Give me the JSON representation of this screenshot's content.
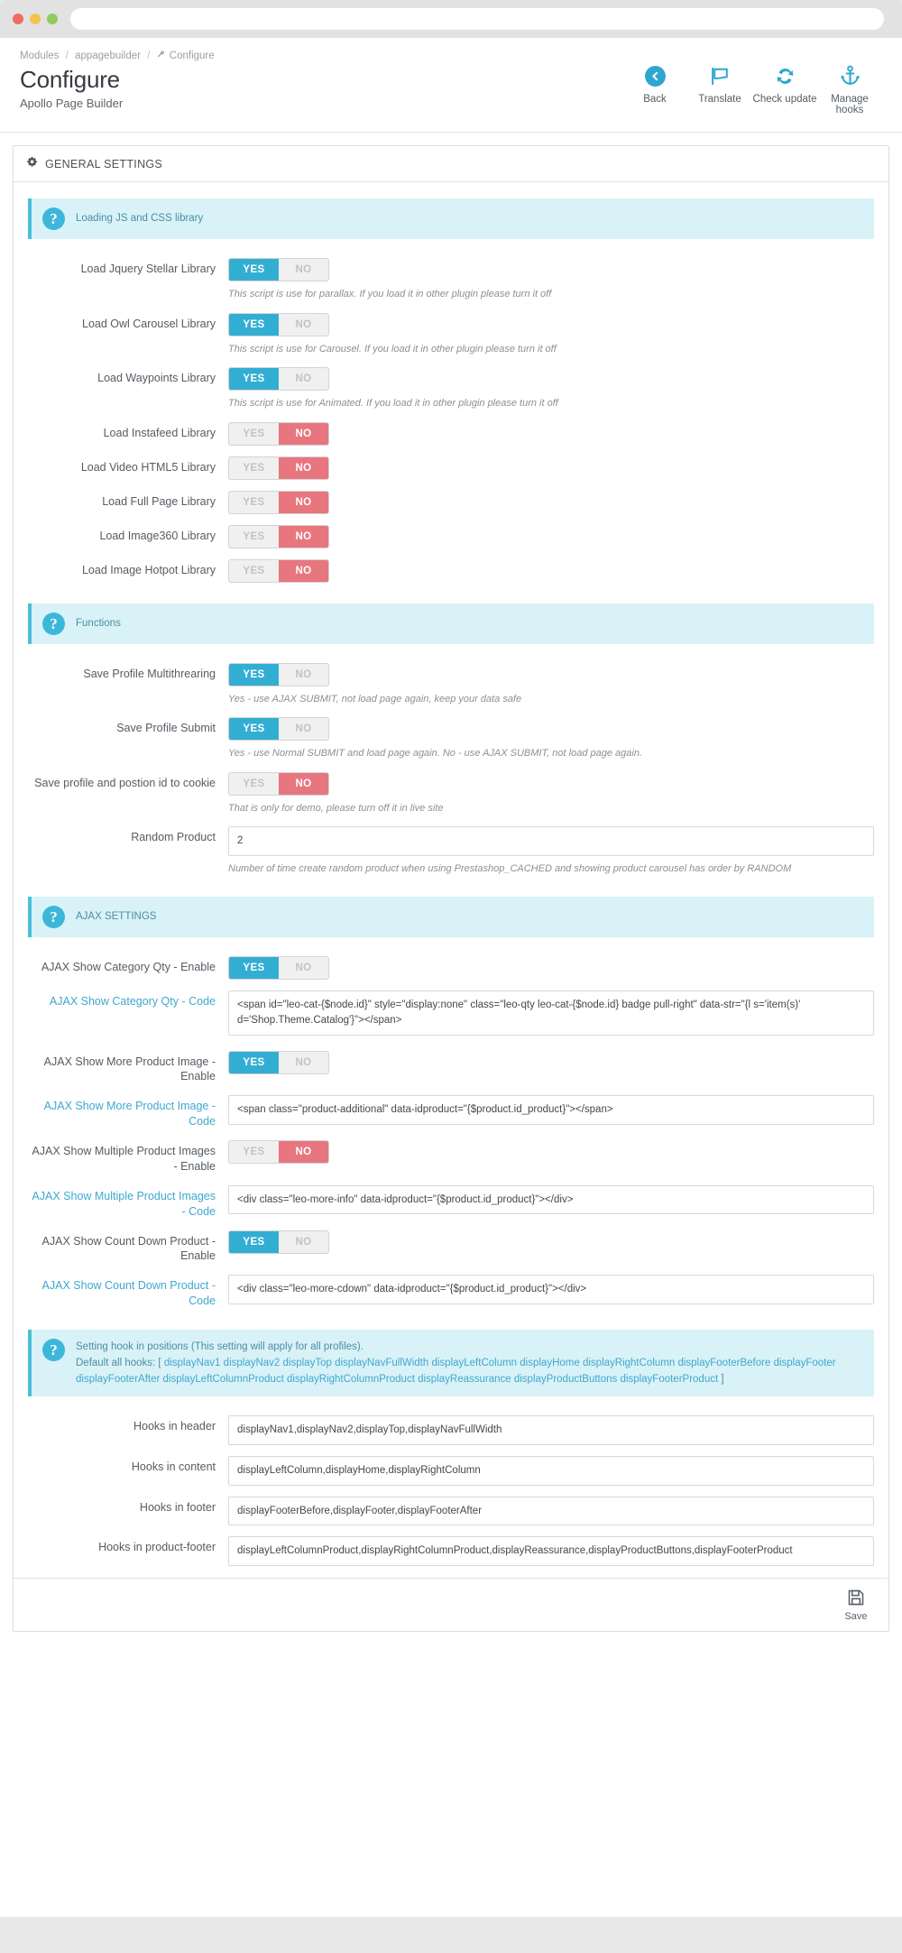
{
  "browser": {
    "url": ""
  },
  "header": {
    "breadcrumb": {
      "root": "Modules",
      "module": "appagebuilder",
      "current": "Configure"
    },
    "title": "Configure",
    "subtitle": "Apollo Page Builder",
    "actions": [
      {
        "label": "Back",
        "icon": "arrow-circle-left-icon"
      },
      {
        "label": "Translate",
        "icon": "flag-icon"
      },
      {
        "label": "Check update",
        "icon": "refresh-icon"
      },
      {
        "label": "Manage hooks",
        "icon": "anchor-icon"
      }
    ]
  },
  "panel": {
    "title": "GENERAL SETTINGS",
    "icon": "gears-icon"
  },
  "sections": {
    "loading": {
      "info": "Loading JS and CSS library",
      "rows": [
        {
          "label": "Load Jquery Stellar Library",
          "value": "YES",
          "yes": "YES",
          "no": "NO",
          "help": "This script is use for parallax. If you load it in other plugin please turn it off"
        },
        {
          "label": "Load Owl Carousel Library",
          "value": "YES",
          "yes": "YES",
          "no": "NO",
          "help": "This script is use for Carousel. If you load it in other plugin please turn it off"
        },
        {
          "label": "Load Waypoints Library",
          "value": "YES",
          "yes": "YES",
          "no": "NO",
          "help": "This script is use for Animated. If you load it in other plugin please turn it off"
        },
        {
          "label": "Load Instafeed Library",
          "value": "NO",
          "yes": "YES",
          "no": "NO",
          "help": ""
        },
        {
          "label": "Load Video HTML5 Library",
          "value": "NO",
          "yes": "YES",
          "no": "NO",
          "help": ""
        },
        {
          "label": "Load Full Page Library",
          "value": "NO",
          "yes": "YES",
          "no": "NO",
          "help": ""
        },
        {
          "label": "Load Image360 Library",
          "value": "NO",
          "yes": "YES",
          "no": "NO",
          "help": ""
        },
        {
          "label": "Load Image Hotpot Library",
          "value": "NO",
          "yes": "YES",
          "no": "NO",
          "help": ""
        }
      ]
    },
    "functions": {
      "info": "Functions",
      "rows": [
        {
          "label": "Save Profile Multithrearing",
          "value": "YES",
          "yes": "YES",
          "no": "NO",
          "help": "Yes - use AJAX SUBMIT, not load page again, keep your data safe"
        },
        {
          "label": "Save Profile Submit",
          "value": "YES",
          "yes": "YES",
          "no": "NO",
          "help": "Yes - use Normal SUBMIT and load page again. No - use AJAX SUBMIT, not load page again."
        },
        {
          "label": "Save profile and postion id to cookie",
          "value": "NO",
          "yes": "YES",
          "no": "NO",
          "help": "That is only for demo, please turn off it in live site"
        }
      ],
      "random_product": {
        "label": "Random Product",
        "value": "2",
        "help": "Number of time create random product when using Prestashop_CACHED and showing product carousel has order by RANDOM"
      }
    },
    "ajax": {
      "info": "AJAX SETTINGS",
      "groups": [
        {
          "enable_label": "AJAX Show Category Qty - Enable",
          "enable_value": "YES",
          "yes": "YES",
          "no": "NO",
          "code_label": "AJAX Show Category Qty - Code",
          "code_value": "<span id=\"leo-cat-{$node.id}\" style=\"display:none\" class=\"leo-qty leo-cat-{$node.id} badge pull-right\" data-str=\"{l s='item(s)' d='Shop.Theme.Catalog'}\"></span>"
        },
        {
          "enable_label": "AJAX Show More Product Image - Enable",
          "enable_value": "YES",
          "yes": "YES",
          "no": "NO",
          "code_label": "AJAX Show More Product Image - Code",
          "code_value": "<span class=\"product-additional\" data-idproduct=\"{$product.id_product}\"></span>"
        },
        {
          "enable_label": "AJAX Show Multiple Product Images - Enable",
          "enable_value": "NO",
          "yes": "YES",
          "no": "NO",
          "code_label": "AJAX Show Multiple Product Images - Code",
          "code_value": "<div class=\"leo-more-info\" data-idproduct=\"{$product.id_product}\"></div>"
        },
        {
          "enable_label": "AJAX Show Count Down Product - Enable",
          "enable_value": "YES",
          "yes": "YES",
          "no": "NO",
          "code_label": "AJAX Show Count Down Product - Code",
          "code_value": "<div class=\"leo-more-cdown\" data-idproduct=\"{$product.id_product}\"></div>"
        }
      ]
    },
    "hooks": {
      "info_line1": "Setting hook in positions (This setting will apply for all profiles).",
      "info_line2_prefix": "Default all hooks: [",
      "hook_names": [
        "displayNav1",
        "displayNav2",
        "displayTop",
        "displayNavFullWidth",
        "displayLeftColumn",
        "displayHome",
        "displayRightColumn",
        "displayFooterBefore",
        "displayFooter",
        "displayFooterAfter",
        "displayLeftColumnProduct",
        "displayRightColumnProduct",
        "displayReassurance",
        "displayProductButtons",
        "displayFooterProduct"
      ],
      "info_suffix": "]",
      "rows": [
        {
          "label": "Hooks in header",
          "value": "displayNav1,displayNav2,displayTop,displayNavFullWidth"
        },
        {
          "label": "Hooks in content",
          "value": "displayLeftColumn,displayHome,displayRightColumn"
        },
        {
          "label": "Hooks in footer",
          "value": "displayFooterBefore,displayFooter,displayFooterAfter"
        },
        {
          "label": "Hooks in product-footer",
          "value": "displayLeftColumnProduct,displayRightColumnProduct,displayReassurance,displayProductButtons,displayFooterProduct"
        }
      ]
    }
  },
  "footer": {
    "save_label": "Save",
    "save_icon": "floppy-disk-icon"
  },
  "colors": {
    "accent": "#33aed3",
    "danger": "#e8767f",
    "info_bg": "#d9f2f8",
    "info_text": "#4a8ea3"
  }
}
